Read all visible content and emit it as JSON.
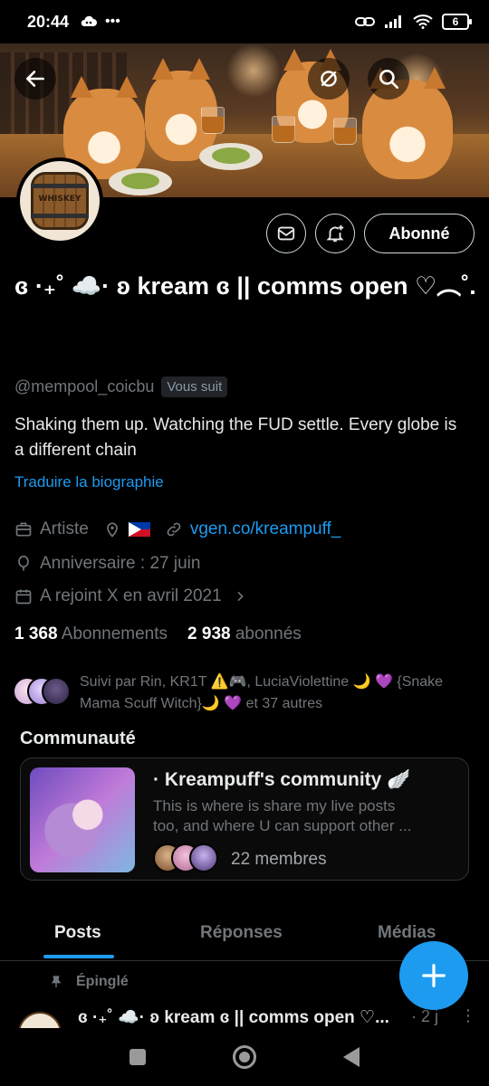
{
  "status_bar": {
    "time": "20:44",
    "battery": "6",
    "left_icons": [
      "cloud-game-icon",
      "more-dots-icon"
    ],
    "right_icons": [
      "link-icon",
      "signal-icon",
      "wifi-icon",
      "battery-icon"
    ]
  },
  "header": {
    "back_icon": "arrow-left-icon",
    "grok_icon": "grok-icon",
    "search_icon": "search-icon",
    "banner_text": "WHISKEY"
  },
  "actions": {
    "message_icon": "mail-icon",
    "notify_icon": "bell-plus-icon",
    "follow_label": "Abonné"
  },
  "profile": {
    "display_name": "ɞ ·₊˚ ☁️· ʚ kream ɞ || comms open ♡︵˚.",
    "handle": "@mempool_coicbu",
    "follows_you": "Vous suit",
    "bio": "Shaking them up. Watching the FUD settle. Every globe is a different chain",
    "translate_label": "Traduire la biographie",
    "category": "Artiste",
    "location_icon": "location-pin-icon",
    "link": "vgen.co/kreampuff_",
    "birthday": "Anniversaire : 27 juin",
    "joined": "A rejoint X en avril 2021",
    "following_count": "1 368",
    "following_label": "Abonnements",
    "followers_count": "2 938",
    "followers_label": "abonnés",
    "followed_by": "Suivi par Rin, KR1T ⚠️🎮, LuciaViolettine 🌙 💜 {Snake Mama Scuff Witch}🌙 💜 et 37 autres"
  },
  "community": {
    "section_title": "Communauté",
    "name": "· Kreampuff's community 🪽",
    "description_line1": "This is where is share my live posts",
    "description_line2": "too, and where U can support other ...",
    "members": "22 membres"
  },
  "tabs": [
    {
      "label": "Posts",
      "active": true
    },
    {
      "label": "Réponses",
      "active": false
    },
    {
      "label": "Médias",
      "active": false
    }
  ],
  "pinned_post": {
    "pinned_label": "Épinglé",
    "author": "ɞ ·₊˚ ☁️· ʚ kream ɞ || comms open ♡...",
    "time": "· 2 j",
    "more": "⋮"
  },
  "fab": {
    "icon": "plus-icon"
  },
  "nav_bar": {
    "icons": [
      "recents-square-icon",
      "home-circle-icon",
      "back-triangle-icon"
    ]
  },
  "colors": {
    "accent": "#1d9bf0",
    "background": "#000000",
    "muted": "#71767b"
  }
}
